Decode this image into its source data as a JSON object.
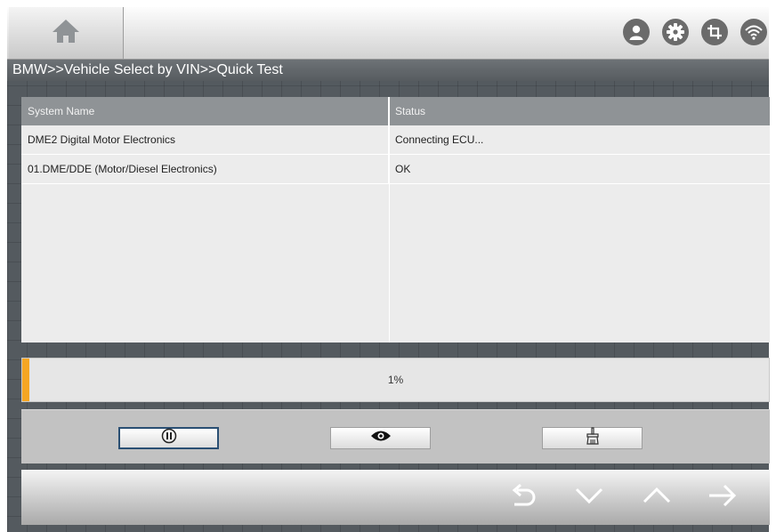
{
  "toolbar": {
    "home_icon": "home-icon",
    "icons": [
      "user-icon",
      "gear-icon",
      "screenshot-icon",
      "wifi-icon"
    ]
  },
  "breadcrumb": "BMW>>Vehicle Select by VIN>>Quick Test",
  "table": {
    "columns": [
      "System Name",
      "Status"
    ],
    "rows": [
      [
        "DME2 Digital Motor Electronics",
        "Connecting ECU..."
      ],
      [
        "01.DME/DDE (Motor/Diesel Electronics)",
        "OK"
      ]
    ]
  },
  "progress": {
    "label": "1%",
    "value": 0.01,
    "color": "#f5a623"
  },
  "actions": [
    "pause-icon",
    "eye-icon",
    "clear-icon"
  ],
  "navigation": [
    "back-icon",
    "down-icon",
    "up-icon",
    "forward-icon"
  ],
  "colors": {
    "accent": "#f5a623",
    "selected_border": "#2a4f73"
  }
}
